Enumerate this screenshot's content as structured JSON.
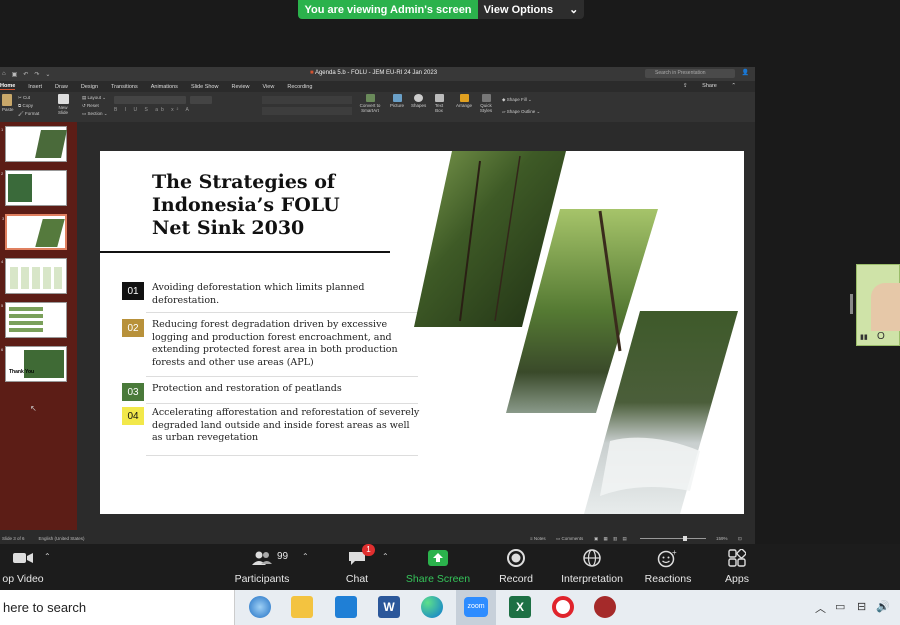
{
  "zoom": {
    "banner_text": "You are viewing Admin's screen",
    "view_options": "View Options",
    "controls": {
      "stop_video": "op Video",
      "participants_count": "99",
      "participants": "Participants",
      "chat": "Chat",
      "chat_badge": "1",
      "share_screen": "Share Screen",
      "record": "Record",
      "interpretation": "Interpretation",
      "reactions": "Reactions",
      "apps": "Apps"
    },
    "participant_tile_letter": "O"
  },
  "ppt": {
    "doc_title": "Agenda 5.b - FOLU - JEM EU-RI 24 Jan 2023",
    "search_placeholder": "Search in Presentation",
    "tabs": [
      "Home",
      "Insert",
      "Draw",
      "Design",
      "Transitions",
      "Animations",
      "Slide Show",
      "Review",
      "View",
      "Recording"
    ],
    "share": "Share",
    "ribbon": {
      "paste": "Paste",
      "cut": "Cut",
      "copy": "Copy",
      "format": "Format",
      "new_slide": "New Slide",
      "layout": "Layout",
      "reset": "Reset",
      "section": "Section",
      "convert_smartart": "Convert to SmartArt",
      "picture": "Picture",
      "shapes": "Shapes",
      "text_box": "Text Box",
      "arrange": "Arrange",
      "quick_styles": "Quick Styles",
      "shape_fill": "Shape Fill",
      "shape_outline": "Shape Outline"
    },
    "status": {
      "slide": "Slide 3 of 6",
      "language": "English (United States)",
      "notes": "Notes",
      "comments": "Comments",
      "zoom": "159%"
    },
    "thumbnails": [
      {
        "num": "1"
      },
      {
        "num": "2"
      },
      {
        "num": "3"
      },
      {
        "num": "4"
      },
      {
        "num": "5"
      },
      {
        "num": "6",
        "label": "Thank You"
      }
    ]
  },
  "slide": {
    "title": "The Strategies of Indonesia’s FOLU Net Sink 2030",
    "items": [
      {
        "num": "01",
        "text": "Avoiding deforestation which limits planned deforestation.",
        "color": "#111111",
        "num_color": "#ffffff"
      },
      {
        "num": "02",
        "text": "Reducing forest degradation driven by excessive logging and production forest encroachment, and extending protected forest area in both production forests and other use areas (APL)",
        "color": "#b8913a",
        "num_color": "#ffffff"
      },
      {
        "num": "03",
        "text": "Protection and restoration of peatlands",
        "color": "#4a7a3a",
        "num_color": "#ffffff"
      },
      {
        "num": "04",
        "text": "Accelerating afforestation and reforestation of severely degraded land outside and inside forest areas as well as urban revegetation",
        "color": "#f2e84a",
        "num_color": "#111111"
      }
    ]
  },
  "taskbar": {
    "search_text": "here to search"
  }
}
